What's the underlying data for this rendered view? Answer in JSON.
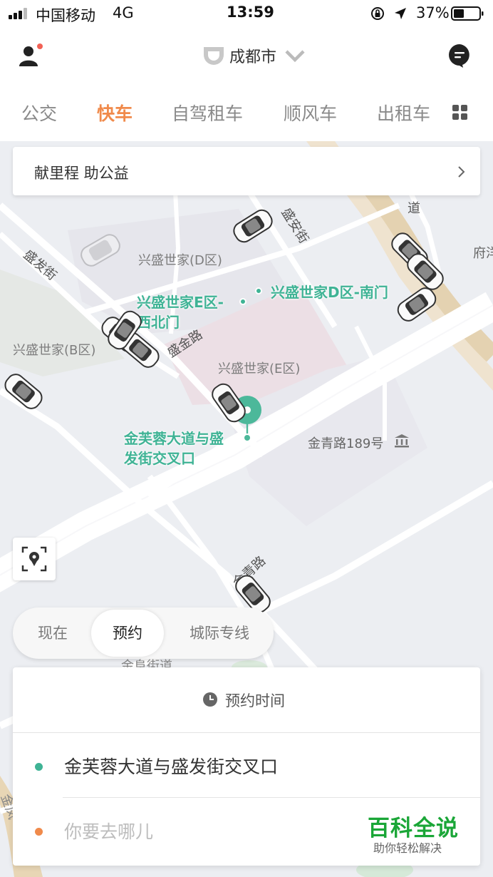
{
  "status_bar": {
    "carrier": "中国移动",
    "network": "4G",
    "time": "13:59",
    "battery": "37%"
  },
  "header": {
    "city": "成都市"
  },
  "service_tabs": [
    {
      "label": "公交",
      "active": false
    },
    {
      "label": "快车",
      "active": true
    },
    {
      "label": "自驾租车",
      "active": false
    },
    {
      "label": "顺风车",
      "active": false
    },
    {
      "label": "出租车",
      "active": false
    }
  ],
  "banner": {
    "text": "献里程 助公益"
  },
  "map": {
    "areas": [
      "兴盛世家(D区)",
      "兴盛世家(B区)",
      "兴盛世家(E区)",
      "金青路189号",
      "府洋"
    ],
    "roads": [
      "盛发街",
      "盛安街",
      "盛金路",
      "道",
      "金青路",
      "金阜街道",
      "金凤"
    ],
    "pois": {
      "e_gate": "兴盛世家E区-西北门",
      "e_gate_line1": "兴盛世家E区-",
      "e_gate_line2": "西北门",
      "d_gate": "兴盛世家D区-南门",
      "pickup_line1": "金芙蓉大道与盛",
      "pickup_line2": "发街交叉口"
    }
  },
  "mode_tabs": [
    {
      "label": "现在",
      "active": false
    },
    {
      "label": "预约",
      "active": true
    },
    {
      "label": "城际专线",
      "active": false
    }
  ],
  "booking": {
    "time_label": "预约时间",
    "from": "金芙蓉大道与盛发街交叉口",
    "to_placeholder": "你要去哪儿"
  },
  "watermark": {
    "title": "百科全说",
    "subtitle": "助你轻松解决"
  },
  "colors": {
    "accent_orange": "#f08a4b",
    "accent_green": "#3fb395",
    "watermark_green": "#1aa637"
  },
  "icons": [
    "signal-icon",
    "lock-rotation-icon",
    "location-arrow-icon",
    "battery-icon",
    "user-icon",
    "didi-logo-icon",
    "message-icon",
    "grid-icon",
    "chevron-right-icon",
    "car-icon",
    "pickup-pin-icon",
    "museum-icon",
    "locate-icon",
    "clock-icon"
  ]
}
